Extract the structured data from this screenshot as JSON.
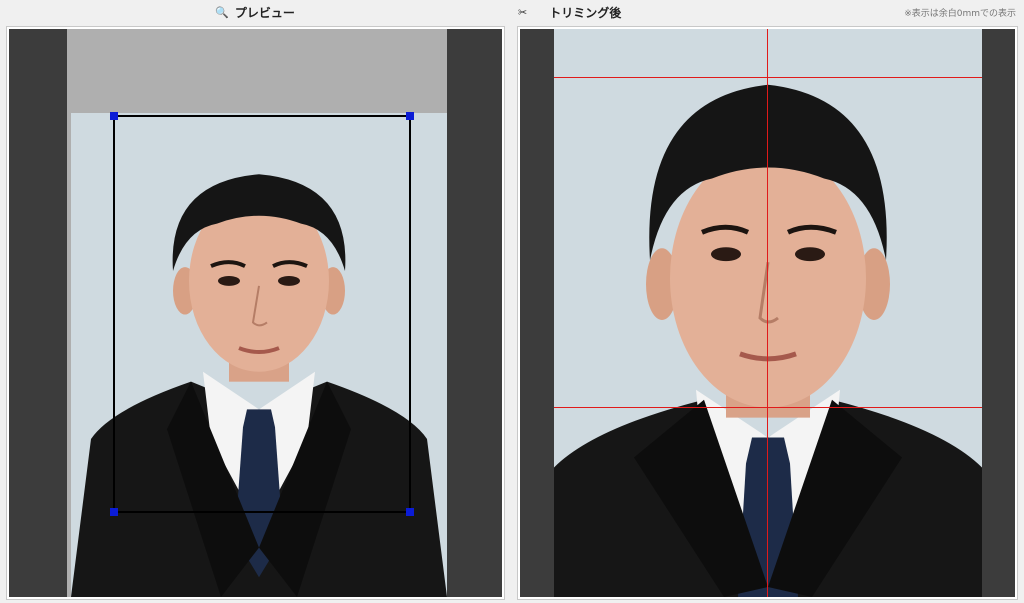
{
  "preview": {
    "icon": "magnifier-icon",
    "title": "プレビュー"
  },
  "trimmed": {
    "icon": "scissors-icon",
    "title": "トリミング後",
    "note": "※表示は余白0mmでの表示"
  },
  "colors": {
    "crop_handle": "#0b1cd6",
    "guide_line": "#e01a1a",
    "background_photo": "#cfdae0"
  }
}
